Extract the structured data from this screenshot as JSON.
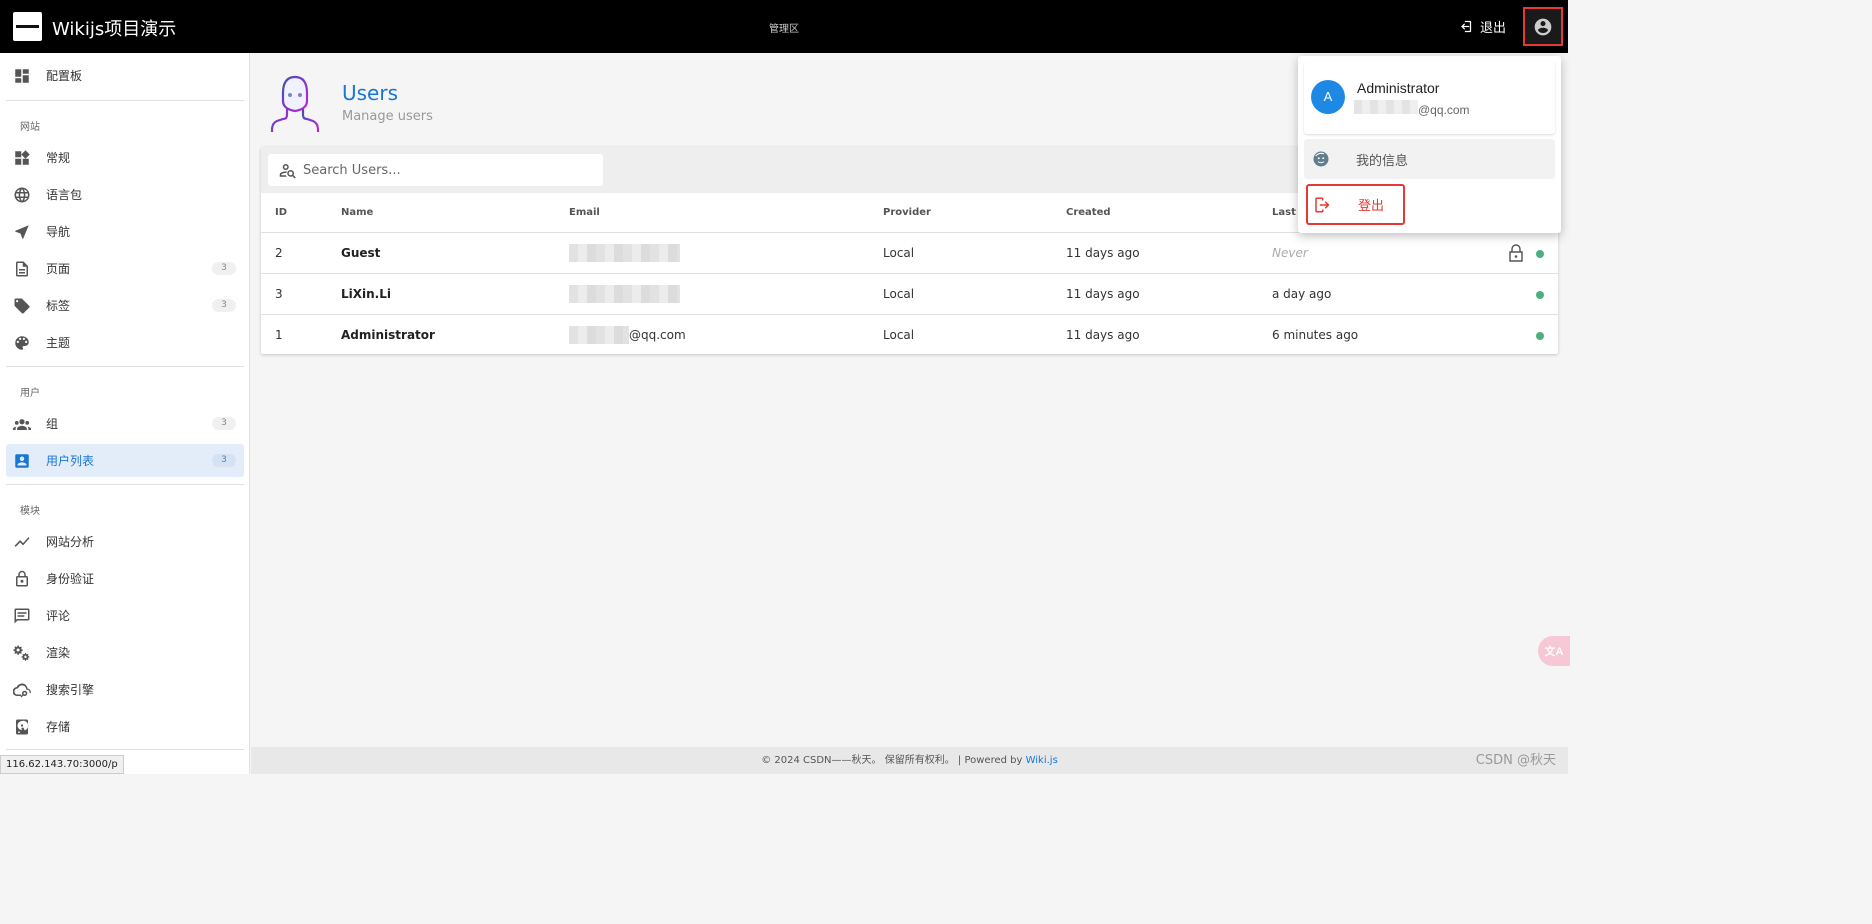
{
  "topbar": {
    "app_title": "Wikijs项目演示",
    "admin_area": "管理区",
    "logout_label": "退出"
  },
  "sidebar": {
    "dashboard": {
      "label": "配置板",
      "icon": "dashboard-icon"
    },
    "sections": {
      "site": "网站",
      "users": "用户",
      "modules": "模块"
    },
    "site_items": [
      {
        "label": "常规",
        "icon": "widgets-icon"
      },
      {
        "label": "语言包",
        "icon": "globe-icon"
      },
      {
        "label": "导航",
        "icon": "navigation-icon"
      },
      {
        "label": "页面",
        "icon": "file-icon",
        "badge": "3"
      },
      {
        "label": "标签",
        "icon": "tags-icon",
        "badge": "3"
      },
      {
        "label": "主题",
        "icon": "palette-icon"
      }
    ],
    "user_items": [
      {
        "label": "组",
        "icon": "group-icon",
        "badge": "3"
      },
      {
        "label": "用户列表",
        "icon": "account-box-icon",
        "badge": "3",
        "active": true
      }
    ],
    "module_items": [
      {
        "label": "网站分析",
        "icon": "chart-line-icon"
      },
      {
        "label": "身份验证",
        "icon": "lock-icon"
      },
      {
        "label": "评论",
        "icon": "comment-icon"
      },
      {
        "label": "渲染",
        "icon": "cogs-icon"
      },
      {
        "label": "搜索引擎",
        "icon": "cloud-search-icon"
      },
      {
        "label": "存储",
        "icon": "harddisk-icon"
      }
    ]
  },
  "status_url": "116.62.143.70:3000/p",
  "main": {
    "title": "Users",
    "subtitle": "Manage users",
    "search_placeholder": "Search Users...",
    "columns": [
      "ID",
      "Name",
      "Email",
      "Provider",
      "Created",
      "Last L"
    ],
    "rows": [
      {
        "id": "2",
        "name": "Guest",
        "email": "",
        "provider": "Local",
        "created": "11 days ago",
        "last_login": "Never",
        "locked": true
      },
      {
        "id": "3",
        "name": "LiXin.Li",
        "email": "",
        "provider": "Local",
        "created": "11 days ago",
        "last_login": "a day ago",
        "locked": false
      },
      {
        "id": "1",
        "name": "Administrator",
        "email": "@qq.com",
        "provider": "Local",
        "created": "11 days ago",
        "last_login": "6 minutes ago",
        "locked": false
      }
    ]
  },
  "dropdown": {
    "avatar_letter": "A",
    "name": "Administrator",
    "email": "@qq.com",
    "my_info": "我的信息",
    "logout": "登出"
  },
  "footer": {
    "text": "© 2024 CSDN——秋天。 保留所有权利。 | Powered by ",
    "link": "Wiki.js"
  },
  "watermark": "CSDN @秋天",
  "colors": {
    "accent": "#1976d2",
    "highlight_border": "#e53935",
    "status_dot": "#4caf7d",
    "avatar_bg": "#1e88e5"
  }
}
